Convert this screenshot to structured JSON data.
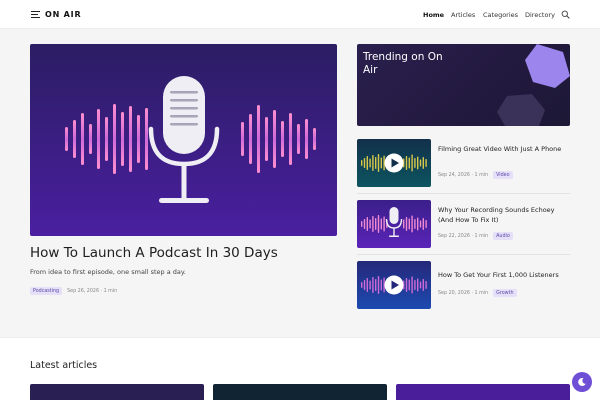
{
  "header": {
    "brand": "ON AIR",
    "nav": [
      {
        "label": "Home",
        "active": true
      },
      {
        "label": "Articles",
        "active": false
      },
      {
        "label": "Categories",
        "active": false
      },
      {
        "label": "Directory",
        "active": false
      }
    ],
    "icons": [
      "menu-icon",
      "search-icon"
    ]
  },
  "hero": {
    "title": "How To Launch A Podcast In 30 Days",
    "subtitle": "From idea to first episode, one small step a day.",
    "tag": "Podcasting",
    "date": "Sep 26, 2026 · 1 min",
    "icon": "microphone-icon"
  },
  "trending": {
    "title": "Trending on On Air"
  },
  "cards": [
    {
      "title": "Filming Great Video With Just A Phone",
      "date": "Sep 24, 2026 · 1 min",
      "tag": "Video",
      "icon": "play-icon"
    },
    {
      "title": "Why Your Recording Sounds Echoey (And How To Fix It)",
      "date": "Sep 22, 2026 · 1 min",
      "tag": "Audio",
      "icon": "microphone-icon"
    },
    {
      "title": "How To Get Your First 1,000 Listeners",
      "date": "Sep 20, 2026 · 1 min",
      "tag": "Growth",
      "icon": "play-icon"
    }
  ],
  "latest": {
    "title": "Latest articles"
  },
  "theme_toggle": {
    "icon": "moon-icon"
  },
  "colors": {
    "accent": "#6f4fd6",
    "tag_bg": "#e5dff8",
    "tag_text": "#5c4aa8",
    "hero_bg_top": "#2b1d63",
    "hero_bg_bottom": "#4a1fa0"
  }
}
